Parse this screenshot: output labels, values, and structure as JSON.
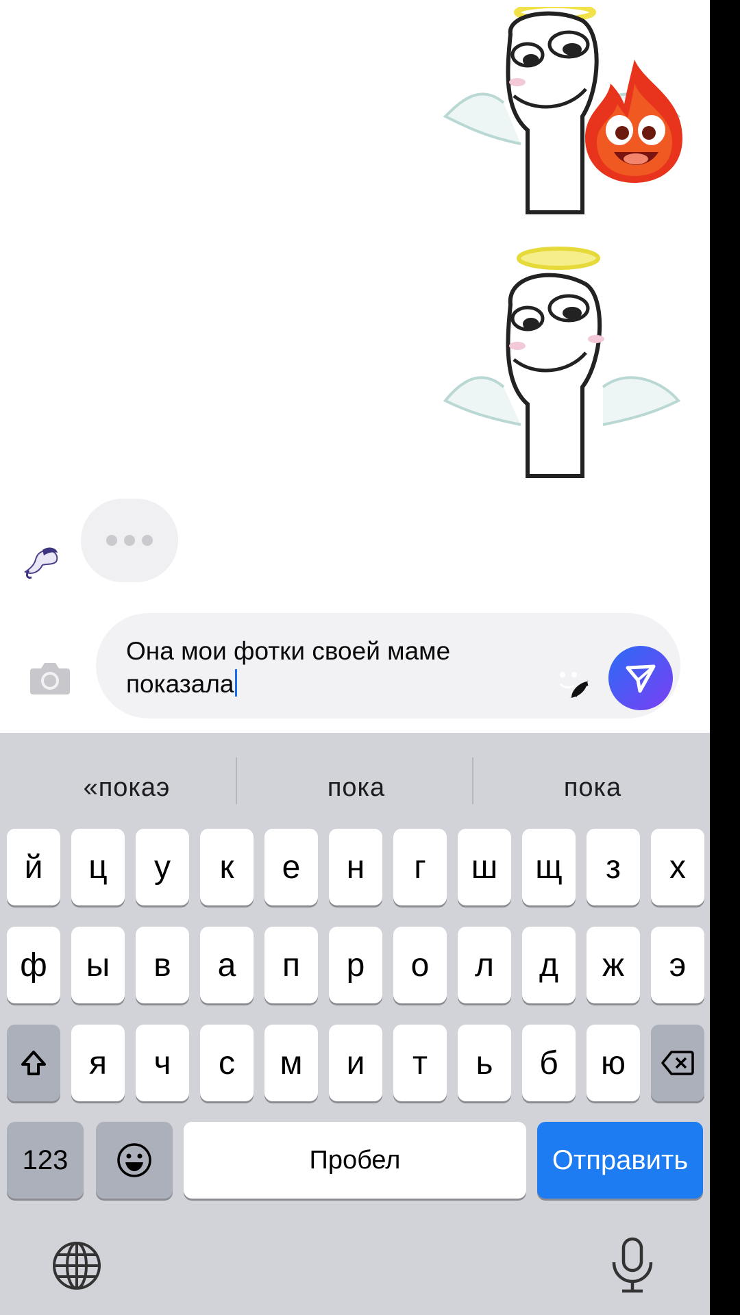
{
  "chat": {
    "typing_indicator": "typing"
  },
  "composer": {
    "message_text": "Она мои фотки своей маме показала"
  },
  "suggestions": [
    "«покаэ",
    "пока",
    "пока"
  ],
  "keyboard": {
    "row1": [
      "й",
      "ц",
      "у",
      "к",
      "е",
      "н",
      "г",
      "ш",
      "щ",
      "з",
      "х"
    ],
    "row2": [
      "ф",
      "ы",
      "в",
      "а",
      "п",
      "р",
      "о",
      "л",
      "д",
      "ж",
      "э"
    ],
    "row3": [
      "я",
      "ч",
      "с",
      "м",
      "и",
      "т",
      "ь",
      "б",
      "ю"
    ],
    "numbers_label": "123",
    "space_label": "Пробел",
    "send_label": "Отправить"
  },
  "colors": {
    "send_button": "#1d7cf2",
    "keyboard_bg": "#d1d3d9",
    "accent": "#2b6cf6"
  }
}
